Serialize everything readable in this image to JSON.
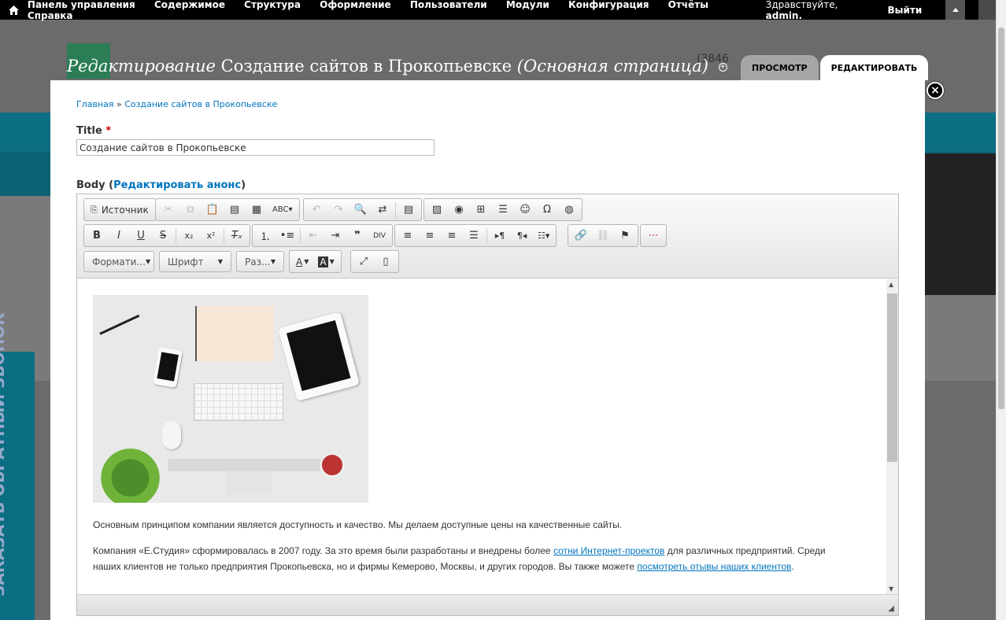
{
  "admin_bar": {
    "menu": [
      "Панель управления",
      "Содержимое",
      "Структура",
      "Оформление",
      "Пользователи",
      "Модули",
      "Конфигурация",
      "Отчёты",
      "Справка"
    ],
    "greeting_prefix": "Здравствуйте,",
    "greeting_user": "admin.",
    "logout": "Выйти"
  },
  "background": {
    "phone_text": "(3846",
    "callback_label": "ЗАКАЗАТЬ ОБРАТНЫЙ ЗВОНОК"
  },
  "overlay": {
    "title_prefix": "Редактирование",
    "title_main": "Создание сайтов в Прокопьевске",
    "title_suffix": "(Основная страница)",
    "tabs": [
      {
        "label": "Просмотр",
        "active": false
      },
      {
        "label": "Редактировать",
        "active": true
      }
    ],
    "close_label": "×"
  },
  "breadcrumb": {
    "home": "Главная",
    "separator": "»",
    "current": "Создание сайтов в Прокопьевске"
  },
  "form": {
    "title_label": "Title",
    "required_mark": "*",
    "title_value": "Создание сайтов в Прокопьевске",
    "body_label": "Body",
    "body_open": "(",
    "edit_summary_link": "Редактировать анонс",
    "body_close": ")"
  },
  "editor": {
    "source_button": "Источник",
    "combos": {
      "format": "Формати...",
      "font": "Шрифт",
      "size": "Раз..."
    },
    "content": {
      "para1": "Основным принципом компании является доступность и качество. Мы делаем доступные цены на качественные сайты.",
      "para2_a": "Компания «Е.Студия» сформировалась в 2007 году. За это время были разработаны и внедрены более ",
      "para2_link1": "сотни Интернет-проектов",
      "para2_b": " для различных предприятий. Среди наших клиентов не только предприятия Прокопьевска, но и фирмы Кемерово, Москвы, и других городов. Вы также можете ",
      "para2_link2": "посмотреть отывы наших клиентов",
      "para2_c": "."
    }
  }
}
